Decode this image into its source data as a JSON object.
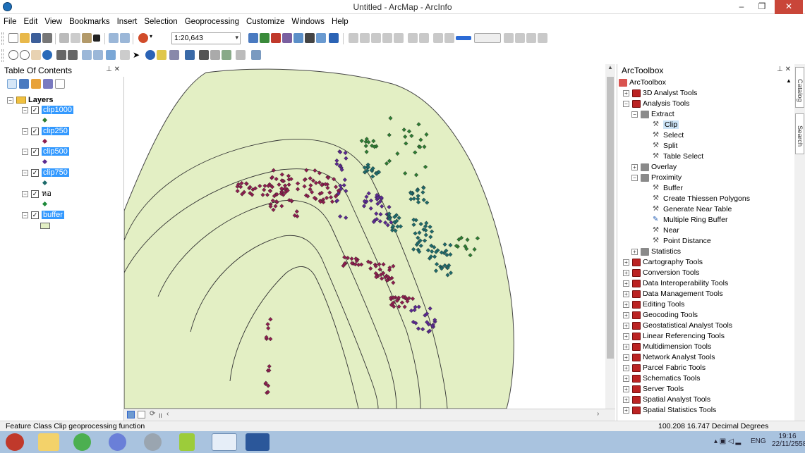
{
  "window": {
    "title": "Untitled - ArcMap - ArcInfo",
    "minimize": "–",
    "restore": "❐",
    "close": "✕"
  },
  "menu": [
    "File",
    "Edit",
    "View",
    "Bookmarks",
    "Insert",
    "Selection",
    "Geoprocessing",
    "Customize",
    "Windows",
    "Help"
  ],
  "toolbar": {
    "scale_value": "1:20,643"
  },
  "toc": {
    "title": "Table Of Contents",
    "root": "Layers",
    "layers": [
      {
        "name": "clip1000",
        "color": "#2e7d32",
        "symbol": "point"
      },
      {
        "name": "clip250",
        "color": "#8e1e4e",
        "symbol": "point"
      },
      {
        "name": "clip500",
        "color": "#5b2a91",
        "symbol": "point"
      },
      {
        "name": "clip750",
        "color": "#1e6b6b",
        "symbol": "point"
      },
      {
        "name": "หอ",
        "color": "#1e8a3a",
        "symbol": "point"
      },
      {
        "name": "buffer",
        "color": "#e3efc4",
        "symbol": "polygon"
      }
    ]
  },
  "toolbox": {
    "title": "ArcToolbox",
    "items": [
      {
        "label": "ArcToolbox",
        "level": 0,
        "kind": "root"
      },
      {
        "label": "3D Analyst Tools",
        "level": 1,
        "kind": "box",
        "exp": "+"
      },
      {
        "label": "Analysis Tools",
        "level": 1,
        "kind": "box",
        "exp": "−"
      },
      {
        "label": "Extract",
        "level": 2,
        "kind": "set",
        "exp": "−"
      },
      {
        "label": "Clip",
        "level": 3,
        "kind": "tool",
        "selected": true
      },
      {
        "label": "Select",
        "level": 3,
        "kind": "tool"
      },
      {
        "label": "Split",
        "level": 3,
        "kind": "tool"
      },
      {
        "label": "Table Select",
        "level": 3,
        "kind": "tool"
      },
      {
        "label": "Overlay",
        "level": 2,
        "kind": "set",
        "exp": "+"
      },
      {
        "label": "Proximity",
        "level": 2,
        "kind": "set",
        "exp": "−"
      },
      {
        "label": "Buffer",
        "level": 3,
        "kind": "tool"
      },
      {
        "label": "Create Thiessen Polygons",
        "level": 3,
        "kind": "tool"
      },
      {
        "label": "Generate Near Table",
        "level": 3,
        "kind": "tool"
      },
      {
        "label": "Multiple Ring Buffer",
        "level": 3,
        "kind": "script"
      },
      {
        "label": "Near",
        "level": 3,
        "kind": "tool"
      },
      {
        "label": "Point Distance",
        "level": 3,
        "kind": "tool"
      },
      {
        "label": "Statistics",
        "level": 2,
        "kind": "set",
        "exp": "+"
      },
      {
        "label": "Cartography Tools",
        "level": 1,
        "kind": "box",
        "exp": "+"
      },
      {
        "label": "Conversion Tools",
        "level": 1,
        "kind": "box",
        "exp": "+"
      },
      {
        "label": "Data Interoperability Tools",
        "level": 1,
        "kind": "box",
        "exp": "+"
      },
      {
        "label": "Data Management Tools",
        "level": 1,
        "kind": "box",
        "exp": "+"
      },
      {
        "label": "Editing Tools",
        "level": 1,
        "kind": "box",
        "exp": "+"
      },
      {
        "label": "Geocoding Tools",
        "level": 1,
        "kind": "box",
        "exp": "+"
      },
      {
        "label": "Geostatistical Analyst Tools",
        "level": 1,
        "kind": "box",
        "exp": "+"
      },
      {
        "label": "Linear Referencing Tools",
        "level": 1,
        "kind": "box",
        "exp": "+"
      },
      {
        "label": "Multidimension Tools",
        "level": 1,
        "kind": "box",
        "exp": "+"
      },
      {
        "label": "Network Analyst Tools",
        "level": 1,
        "kind": "box",
        "exp": "+"
      },
      {
        "label": "Parcel Fabric Tools",
        "level": 1,
        "kind": "box",
        "exp": "+"
      },
      {
        "label": "Schematics Tools",
        "level": 1,
        "kind": "box",
        "exp": "+"
      },
      {
        "label": "Server Tools",
        "level": 1,
        "kind": "box",
        "exp": "+"
      },
      {
        "label": "Spatial Analyst Tools",
        "level": 1,
        "kind": "box",
        "exp": "+"
      },
      {
        "label": "Spatial Statistics Tools",
        "level": 1,
        "kind": "box",
        "exp": "+"
      }
    ]
  },
  "side_tabs": [
    "Catalog",
    "Search"
  ],
  "status": {
    "message": "Feature Class Clip geoprocessing function",
    "coords": "100.208  16.747 Decimal Degrees"
  },
  "taskbar": {
    "lang": "ENG",
    "time": "19:16",
    "date": "22/11/2558"
  },
  "colors": {
    "buffer_fill": "#e3efc4",
    "selection": "#3399ff",
    "close_button": "#c94639",
    "taskbar": "#a9c3df"
  }
}
